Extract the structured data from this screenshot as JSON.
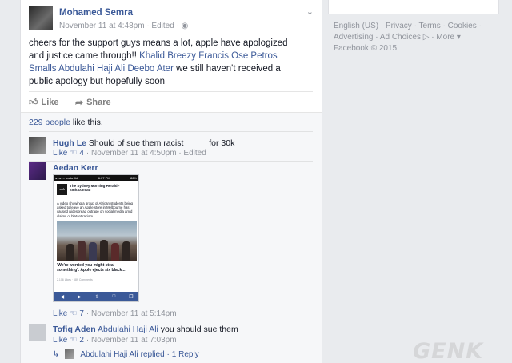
{
  "post": {
    "author": "Mohamed Semra",
    "meta": "November 11 at 4:48pm · Edited · ",
    "text_before": "cheers for the support guys means a lot, apple have apologized and justice came through!! ",
    "tagged": "Khalid Breezy Francis Ose Petros Smalls Abdulahi Haji Ali Deebo Ater",
    "text_after": " we still haven't received a public apology but hopefully soon",
    "like_label": "Like",
    "share_label": "Share",
    "likes_count": "229 people",
    "likes_suffix": " like this."
  },
  "comments": [
    {
      "name": "Hugh Le",
      "text": "Should of sue them racist",
      "text_tail": "for 30k",
      "like_label": "Like",
      "likes": "4",
      "meta": "· November 11 at 4:50pm · Edited"
    },
    {
      "name": "Aedan Kerr",
      "like_label": "Like",
      "likes": "7",
      "meta": "· November 11 at 5:14pm",
      "screenshot": {
        "status_left": "●●●○○ voda AU",
        "status_time": "6:07 PM",
        "status_right": "86%",
        "logo": "smh",
        "headline": "The Sydney Morning Herald - smh.com.au",
        "body": "A video showing a group of African students being asked to leave an Apple store in Melbourne has caused widespread outrage on social media amid claims of blatant racism.",
        "caption": "'We're worried you might steal something': Apple ejects six black...",
        "small": "2,106 Likes · 689 Comments"
      }
    },
    {
      "name": "Tofiq Aden",
      "text_link": "Abdulahi Haji Ali",
      "text": " you should sue them",
      "like_label": "Like",
      "likes": "2",
      "meta": "· November 11 at 7:03pm"
    }
  ],
  "reply_line": {
    "name": "Abdulahi Haji Ali",
    "action": " replied · ",
    "count": "1 Reply"
  },
  "sidebar_links": {
    "line1": "English (US) · Privacy · Terms · Cookies ·",
    "line2": "Advertising · Ad Choices ▷ · More ▾",
    "line3": "Facebook © 2015"
  },
  "watermark": "GENK",
  "colors": {
    "link": "#3b5998",
    "muted": "#90949c",
    "background": "#e9ebee"
  }
}
